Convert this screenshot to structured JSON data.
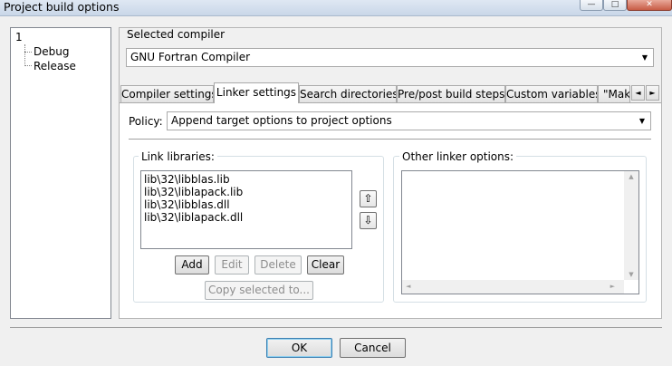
{
  "window": {
    "title": "Project build options",
    "minimize_glyph": "—",
    "maximize_glyph": "□",
    "close_glyph": "✕"
  },
  "tree": {
    "root": "1",
    "children": [
      "Debug",
      "Release"
    ]
  },
  "compiler": {
    "group_label": "Selected compiler",
    "selected": "GNU Fortran Compiler"
  },
  "tabs": {
    "items": [
      "Compiler settings",
      "Linker settings",
      "Search directories",
      "Pre/post build steps",
      "Custom variables",
      "\"Make"
    ],
    "active": "Linker settings",
    "scroll_left_glyph": "◄",
    "scroll_right_glyph": "►"
  },
  "policy": {
    "label": "Policy:",
    "selected": "Append target options to project options"
  },
  "link_libraries": {
    "label": "Link libraries:",
    "items": [
      "lib\\32\\libblas.lib",
      "lib\\32\\liblapack.lib",
      "lib\\32\\libblas.dll",
      "lib\\32\\liblapack.dll"
    ],
    "move_up_glyph": "⇧",
    "move_down_glyph": "⇩",
    "buttons": {
      "add": "Add",
      "edit": "Edit",
      "delete": "Delete",
      "clear": "Clear",
      "copy_selected": "Copy selected to..."
    }
  },
  "other_linker": {
    "label": "Other linker options:",
    "value": ""
  },
  "dialog_buttons": {
    "ok": "OK",
    "cancel": "Cancel"
  },
  "icons": {
    "dropdown": "chevron-down-icon",
    "scroll_up": "▲",
    "scroll_down": "▼",
    "scroll_left": "◄",
    "scroll_right": "►"
  }
}
